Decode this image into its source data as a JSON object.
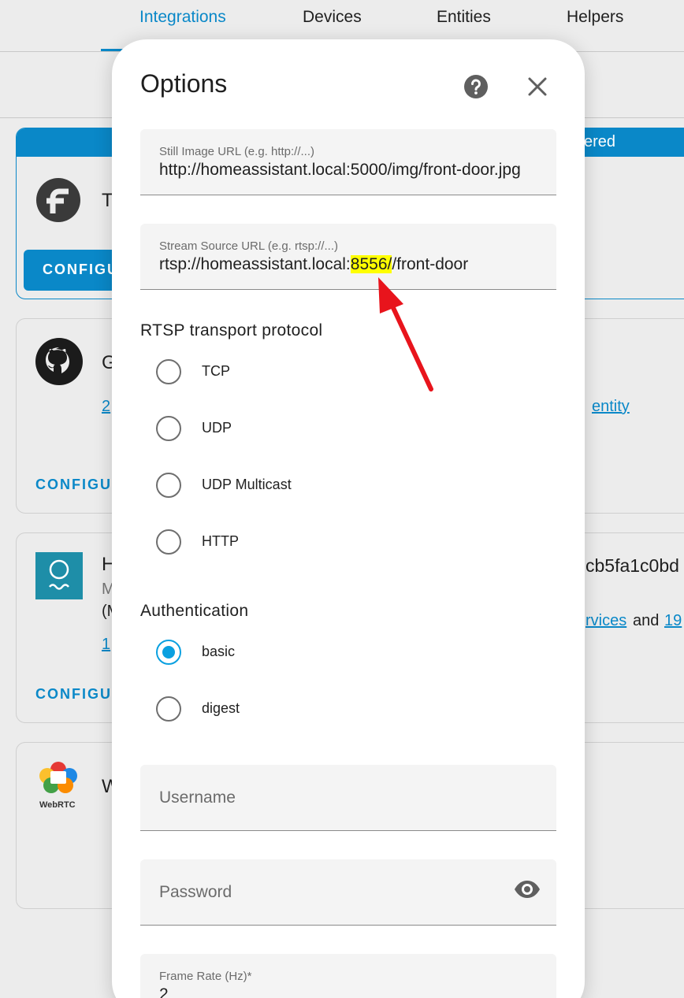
{
  "tabs": [
    {
      "label": "Integrations",
      "active": true
    },
    {
      "label": "Devices",
      "active": false
    },
    {
      "label": "Entities",
      "active": false
    },
    {
      "label": "Helpers",
      "active": false
    }
  ],
  "background": {
    "card1": {
      "title": "T",
      "banner": "ered",
      "configure": "CONFIGU"
    },
    "card2": {
      "title": "G",
      "link_left": "2",
      "link_right": "entity",
      "configure": "CONFIGUR"
    },
    "card3": {
      "title": "H",
      "sub1": "M",
      "sub2": "(M",
      "title_right": "cb5fa1c0bd",
      "link_left": "1",
      "services_link": "rvices",
      "and_text": "and",
      "count_link": "19",
      "configure": "CONFIGUR"
    },
    "card4": {
      "title": "W",
      "logo_text": "WebRTC"
    }
  },
  "dialog": {
    "title": "Options",
    "still_image": {
      "label": "Still Image URL (e.g. http://...)",
      "value": "http://homeassistant.local:5000/img/front-door.jpg"
    },
    "stream_source": {
      "label": "Stream Source URL (e.g. rtsp://...)",
      "value_prefix": "rtsp://homeassistant.local:",
      "value_port": "8556",
      "value_suffix": "/front-door"
    },
    "rtsp_title": "RTSP transport protocol",
    "rtsp_options": [
      "TCP",
      "UDP",
      "UDP Multicast",
      "HTTP"
    ],
    "auth_title": "Authentication",
    "auth_options": [
      "basic",
      "digest"
    ],
    "auth_selected": "basic",
    "username_placeholder": "Username",
    "password_placeholder": "Password",
    "frame_rate": {
      "label": "Frame Rate (Hz)*",
      "value": "2"
    }
  },
  "colors": {
    "accent": "#0a88c8",
    "radio_selected": "#0aa0e0",
    "highlight": "#ffff00",
    "annotation_arrow": "#e8141c"
  }
}
